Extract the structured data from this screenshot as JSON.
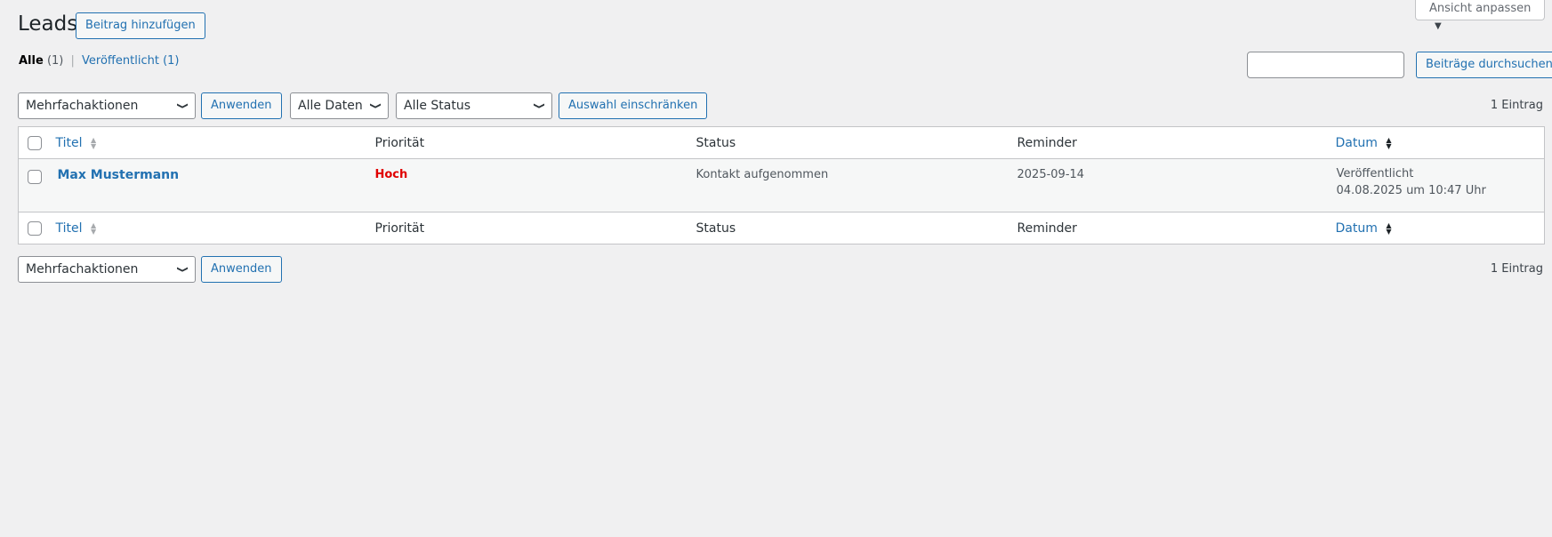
{
  "page": {
    "title": "Leads",
    "add_button": "Beitrag hinzufügen"
  },
  "screen_options": {
    "label": "Ansicht anpassen"
  },
  "views": {
    "all_label": "Alle",
    "all_count": "(1)",
    "separator": "|",
    "published_label": "Veröffentlicht",
    "published_count": "(1)"
  },
  "search": {
    "value": "",
    "placeholder": "",
    "button": "Beiträge durchsuchen"
  },
  "filters_top": {
    "bulk_action": "Mehrfachaktionen",
    "apply": "Anwenden",
    "dates": "Alle Daten",
    "status": "Alle Status",
    "filter_button": "Auswahl einschränken"
  },
  "filters_bottom": {
    "bulk_action": "Mehrfachaktionen",
    "apply": "Anwenden"
  },
  "item_count": "1 Eintrag",
  "table": {
    "columns": {
      "title": "Titel",
      "priority": "Priorität",
      "status": "Status",
      "reminder": "Reminder",
      "date": "Datum"
    },
    "rows": [
      {
        "title": "Max Mustermann",
        "priority": "Hoch",
        "status": "Kontakt aufgenommen",
        "reminder": "2025-09-14",
        "date_status": "Veröffentlicht",
        "date": "04.08.2025 um 10:47 Uhr"
      }
    ]
  },
  "colors": {
    "accent": "#2271b1",
    "priority_high": "#e00000",
    "background": "#f0f0f1"
  },
  "icons": {
    "chevron": "chevron-down-icon",
    "sort": "sort-arrows-icon"
  }
}
